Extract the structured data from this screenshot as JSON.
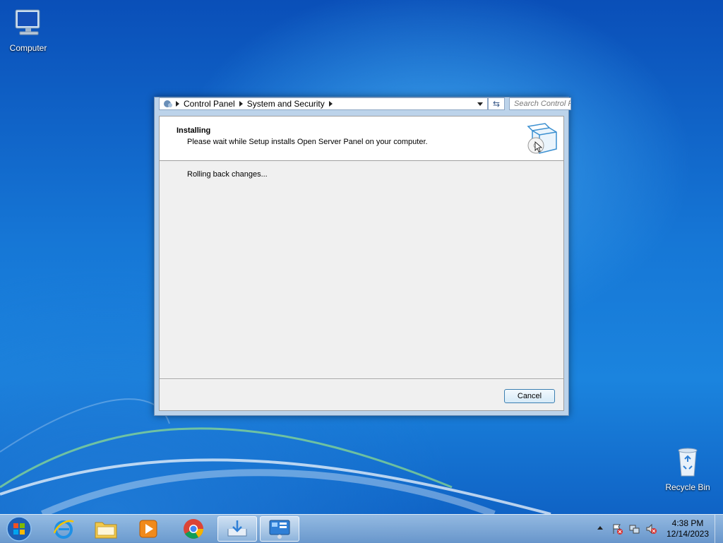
{
  "desktop": {
    "computer_label": "Computer",
    "recycle_label": "Recycle Bin"
  },
  "address_bar": {
    "crumbs": [
      "Control Panel",
      "System and Security"
    ],
    "search_placeholder": "Search Control Panel"
  },
  "installer": {
    "title": "Installing",
    "subtitle": "Please wait while Setup installs Open Server Panel on your computer.",
    "status": "Rolling back changes...",
    "cancel_label": "Cancel"
  },
  "taskbar": {
    "pinned": [
      "start-orb",
      "internet-explorer",
      "windows-explorer",
      "media-player",
      "chrome",
      "downloads",
      "control-panel"
    ],
    "time": "4:38 PM",
    "date": "12/14/2023"
  },
  "colors": {
    "accent": "#3c7fb1",
    "window_frame": "#bcd3ea",
    "dialog_bg": "#f0f0f0"
  }
}
